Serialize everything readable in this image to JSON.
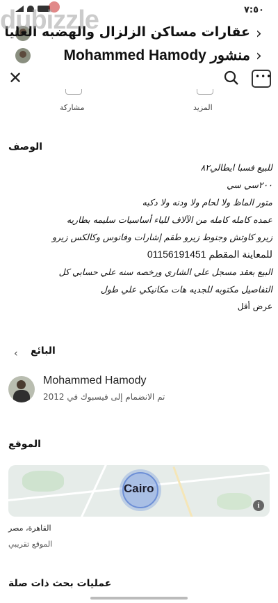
{
  "status_bar": {
    "time": "٧:٥٠"
  },
  "watermark": "dubizzle",
  "nav": {
    "row1_title": "عقارات مساكن الزلزال والهضبه العليا",
    "row2_title": "منشور Mohammed Hamody"
  },
  "actions": {
    "share_label": "مشاركة",
    "more_label": "المزيد"
  },
  "description": {
    "title": "الوصف",
    "lines": [
      "للبيع فسبا ايطالي٨٢",
      "٢٠٠سي سي",
      "متور الماظ ولا لحام ولا ودنه ولا دكبه",
      "عمده كامله كامله من الآلاف للياء أساسيات سليمه بطاريه",
      "زيرو كاوتش وجنوط زيرو طقم إشارات وفانوس وكالكس زيرو",
      "للمعاينة المقطم  01156191451",
      "البيع بعقد مسجل علي الشاري ورخصه سنه علي حسابي كل",
      "التفاصيل مكتوبه للجديه هات مكانيكي علي طول",
      "عرض أقل"
    ]
  },
  "seller": {
    "title": "البائع",
    "name": "Mohammed Hamody",
    "joined": "تم الانضمام إلى فيسبوك في 2012"
  },
  "location": {
    "title": "الموقع",
    "city_label": "Cairo",
    "info_icon": "i",
    "name": "القاهرة، مصر",
    "approx": "الموقع تقريبي"
  },
  "related": {
    "title": "عمليات بحث ذات صلة"
  }
}
